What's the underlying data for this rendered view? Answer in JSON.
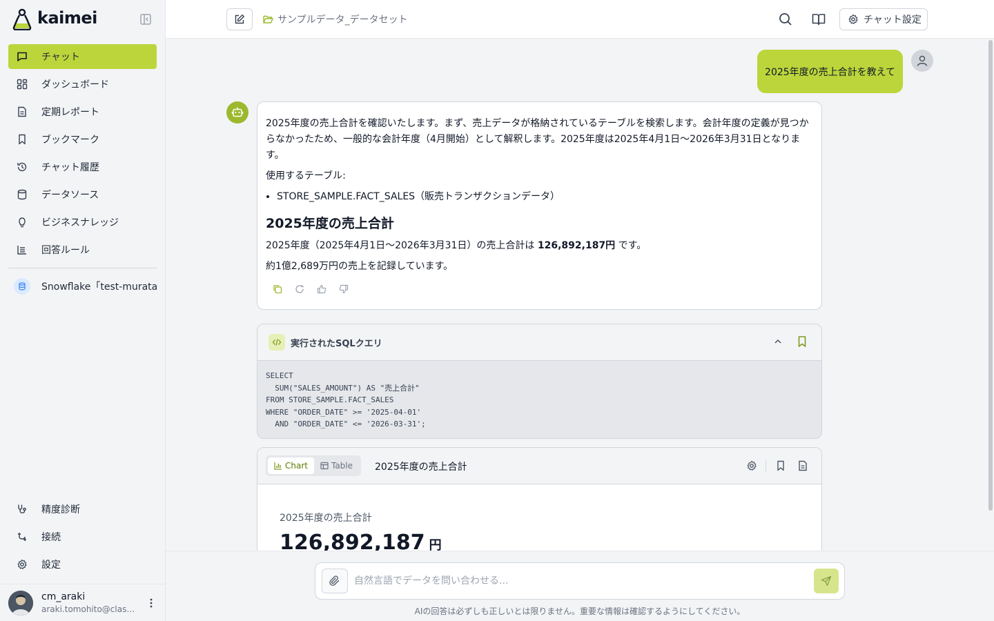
{
  "app": {
    "name": "kaimei"
  },
  "colors": {
    "accent": "#bcd53b",
    "accent_dark": "#9cb82d",
    "text": "#111827"
  },
  "sidebar": {
    "items": [
      {
        "label": "チャット",
        "icon": "chat-bubble-icon",
        "active": true
      },
      {
        "label": "ダッシュボード",
        "icon": "dashboard-icon"
      },
      {
        "label": "定期レポート",
        "icon": "document-icon"
      },
      {
        "label": "ブックマーク",
        "icon": "bookmark-icon"
      },
      {
        "label": "チャット履歴",
        "icon": "history-icon"
      },
      {
        "label": "データソース",
        "icon": "database-icon"
      },
      {
        "label": "ビジネスナレッジ",
        "icon": "lightbulb-icon"
      },
      {
        "label": "回答ルール",
        "icon": "rules-icon"
      }
    ],
    "datasource": {
      "label": "Snowflake「test-murata」",
      "icon": "snowflake-db-icon"
    },
    "bottom_items": [
      {
        "label": "精度診断",
        "icon": "stethoscope-icon"
      },
      {
        "label": "接続",
        "icon": "connection-icon"
      },
      {
        "label": "設定",
        "icon": "gear-icon"
      }
    ],
    "user": {
      "name": "cm_araki",
      "email": "araki.tomohito@classmethod.jp"
    }
  },
  "topbar": {
    "breadcrumb": "サンプルデータ_データセット",
    "settings_label": "チャット設定"
  },
  "chat": {
    "user_message": "2025年度の売上合計を教えて",
    "answer": {
      "intro": "2025年度の売上合計を確認いたします。まず、売上データが格納されているテーブルを検索します。会計年度の定義が見つからなかったため、一般的な会計年度（4月開始）として解釈します。2025年度は2025年4月1日〜2026年3月31日となります。",
      "tables_label": "使用するテーブル:",
      "tables": [
        "STORE_SAMPLE.FACT_SALES（販売トランザクションデータ）"
      ],
      "heading": "2025年度の売上合計",
      "result_prefix": "2025年度（2025年4月1日〜2026年3月31日）の売上合計は ",
      "result_value": "126,892,187円",
      "result_suffix": " です。",
      "summary": "約1億2,689万円の売上を記録しています。"
    },
    "sql": {
      "title": "実行されたSQLクエリ",
      "code": "SELECT\n  SUM(\"SALES_AMOUNT\") AS \"売上合計\"\nFROM STORE_SAMPLE.FACT_SALES\nWHERE \"ORDER_DATE\" >= '2025-04-01'\n  AND \"ORDER_DATE\" <= '2026-03-31';"
    },
    "result_card": {
      "tab_chart": "Chart",
      "tab_table": "Table",
      "active_tab": "Chart",
      "title": "2025年度の売上合計",
      "kpi_label": "2025年度の売上合計",
      "kpi_value": "126,892,187",
      "kpi_unit": "円"
    }
  },
  "input": {
    "placeholder": "自然言語でデータを問い合わせる...",
    "value": "",
    "disclaimer": "AIの回答は必ずしも正しいとは限りません。重要な情報は確認するようにしてください。"
  }
}
